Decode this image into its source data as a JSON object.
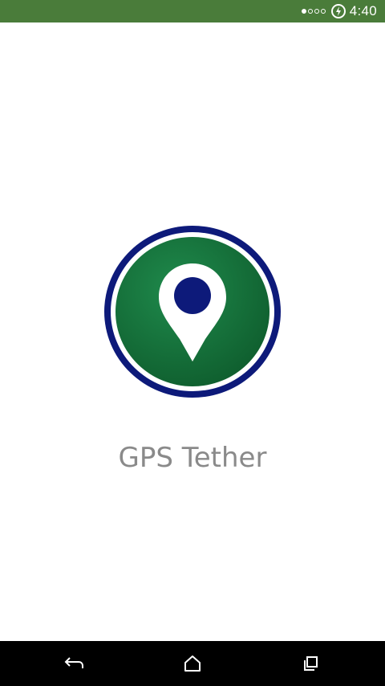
{
  "status_bar": {
    "time": "4:40",
    "signal_icon": "signal-dots-icon",
    "data_saver_icon": "data-saver-icon",
    "background_color": "#4a7c3a"
  },
  "splash": {
    "app_name": "GPS Tether",
    "logo_icon": "location-pin-icon",
    "logo_colors": {
      "outer_ring": "#0d1a7a",
      "inner_circle": "#1f7a45",
      "pin": "#ffffff",
      "pin_dot": "#0d1a7a"
    }
  },
  "nav_bar": {
    "back_icon": "back-arrow-icon",
    "home_icon": "home-icon",
    "recents_icon": "recent-apps-icon"
  }
}
